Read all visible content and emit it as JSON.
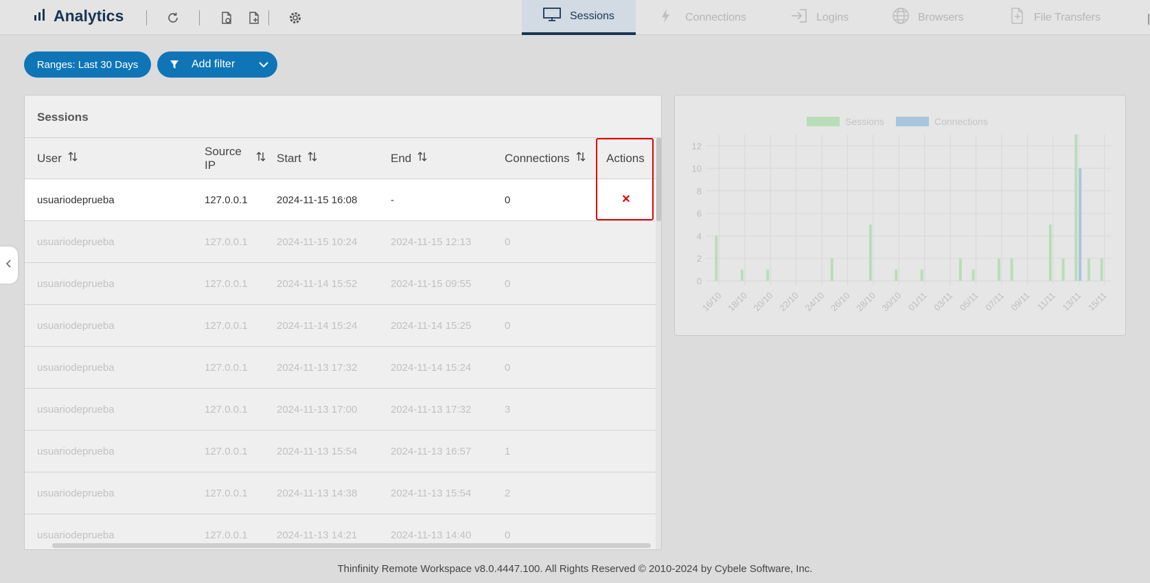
{
  "app": {
    "title": "Analytics"
  },
  "toolbar": {
    "icons": [
      "refresh-icon",
      "export-pdf-icon",
      "export-csv-icon",
      "settings-icon"
    ]
  },
  "nav": {
    "tabs": [
      {
        "label": "Sessions",
        "icon": "monitor-icon",
        "active": true
      },
      {
        "label": "Connections",
        "icon": "lightning-icon",
        "active": false
      },
      {
        "label": "Logins",
        "icon": "login-icon",
        "active": false
      },
      {
        "label": "Browsers",
        "icon": "globe-icon",
        "active": false
      },
      {
        "label": "File Transfers",
        "icon": "file-transfer-icon",
        "active": false
      }
    ]
  },
  "filters": {
    "range_label": "Ranges: Last 30 Days",
    "add_filter_label": "Add filter"
  },
  "sessions": {
    "title": "Sessions",
    "columns": {
      "user": "User",
      "source_ip_line1": "Source",
      "source_ip_line2": "IP",
      "start": "Start",
      "end": "End",
      "connections": "Connections",
      "actions": "Actions"
    },
    "rows": [
      {
        "user": "usuariodeprueba",
        "ip": "127.0.0.1",
        "start": "2024-11-15 16:08",
        "end": "-",
        "connections": "0"
      },
      {
        "user": "usuariodeprueba",
        "ip": "127.0.0.1",
        "start": "2024-11-15 10:24",
        "end": "2024-11-15 12:13",
        "connections": "0"
      },
      {
        "user": "usuariodeprueba",
        "ip": "127.0.0.1",
        "start": "2024-11-14 15:52",
        "end": "2024-11-15 09:55",
        "connections": "0"
      },
      {
        "user": "usuariodeprueba",
        "ip": "127.0.0.1",
        "start": "2024-11-14 15:24",
        "end": "2024-11-14 15:25",
        "connections": "0"
      },
      {
        "user": "usuariodeprueba",
        "ip": "127.0.0.1",
        "start": "2024-11-13 17:32",
        "end": "2024-11-14 15:24",
        "connections": "0"
      },
      {
        "user": "usuariodeprueba",
        "ip": "127.0.0.1",
        "start": "2024-11-13 17:00",
        "end": "2024-11-13 17:32",
        "connections": "3"
      },
      {
        "user": "usuariodeprueba",
        "ip": "127.0.0.1",
        "start": "2024-11-13 15:54",
        "end": "2024-11-13 16:57",
        "connections": "1"
      },
      {
        "user": "usuariodeprueba",
        "ip": "127.0.0.1",
        "start": "2024-11-13 14:38",
        "end": "2024-11-13 15:54",
        "connections": "2"
      },
      {
        "user": "usuariodeprueba",
        "ip": "127.0.0.1",
        "start": "2024-11-13 14:21",
        "end": "2024-11-13 14:40",
        "connections": "0"
      }
    ]
  },
  "chart_data": {
    "type": "bar",
    "title": "",
    "xlabel": "",
    "ylabel": "",
    "ylim": [
      0,
      13
    ],
    "yticks": [
      0,
      2,
      4,
      6,
      8,
      10,
      12
    ],
    "grid": true,
    "legend": "top",
    "tick_labels": [
      "16/10",
      "18/10",
      "20/10",
      "22/10",
      "24/10",
      "26/10",
      "28/10",
      "30/10",
      "01/11",
      "03/11",
      "05/11",
      "07/11",
      "09/11",
      "11/11",
      "13/11",
      "15/11"
    ],
    "categories": [
      "16/10",
      "17/10",
      "18/10",
      "19/10",
      "20/10",
      "21/10",
      "22/10",
      "23/10",
      "24/10",
      "25/10",
      "26/10",
      "27/10",
      "28/10",
      "29/10",
      "30/10",
      "31/10",
      "01/11",
      "02/11",
      "03/11",
      "04/11",
      "05/11",
      "06/11",
      "07/11",
      "08/11",
      "09/11",
      "10/11",
      "11/11",
      "12/11",
      "13/11",
      "14/11",
      "15/11"
    ],
    "series": [
      {
        "name": "Sessions",
        "color": "#b9ddb8",
        "values": [
          4,
          0,
          1,
          0,
          1,
          0,
          0,
          0,
          0,
          2,
          0,
          0,
          5,
          0,
          1,
          0,
          1,
          0,
          0,
          2,
          1,
          0,
          2,
          2,
          0,
          0,
          5,
          2,
          13,
          2,
          2
        ]
      },
      {
        "name": "Connections",
        "color": "#a9c5dd",
        "values": [
          0,
          0,
          0,
          0,
          0,
          0,
          0,
          0,
          0,
          0,
          0,
          0,
          0,
          0,
          0,
          0,
          0,
          0,
          0,
          0,
          0,
          0,
          0,
          0,
          0,
          0,
          0,
          0,
          10,
          0,
          0
        ]
      }
    ]
  },
  "footer": {
    "text": "Thinfinity Remote Workspace v8.0.4447.100. All Rights Reserved © 2010-2024 by Cybele Software, Inc."
  }
}
